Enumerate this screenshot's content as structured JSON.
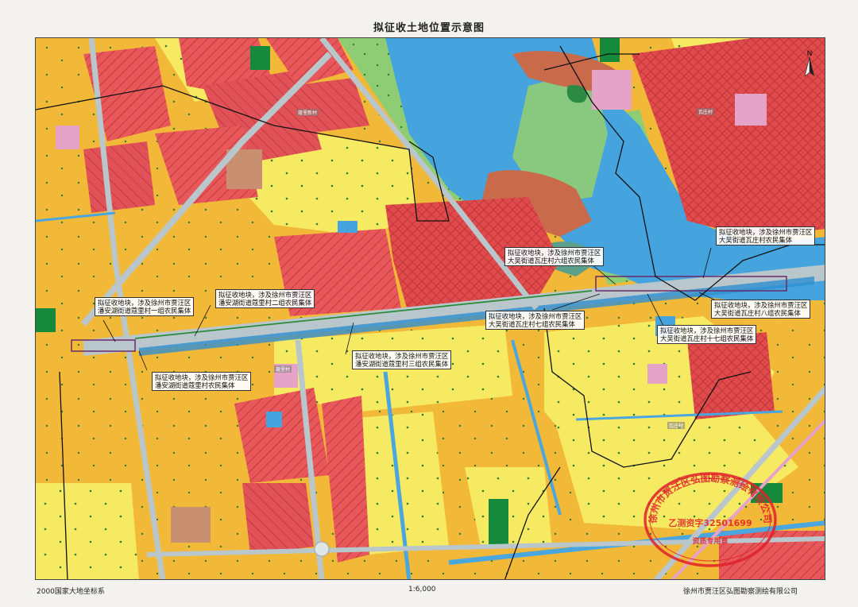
{
  "title": "拟征收土地位置示意图",
  "north_symbol": "N",
  "labels": [
    {
      "lines": [
        "拟征收地块，涉及徐州市贾汪区",
        "潘安湖街道蔻里村一组农民集体"
      ]
    },
    {
      "lines": [
        "拟征收地块，涉及徐州市贾汪区",
        "潘安湖街道蔻里村二组农民集体"
      ]
    },
    {
      "lines": [
        "拟征收地块，涉及徐州市贾汪区",
        "潘安湖街道蔻里村农民集体"
      ]
    },
    {
      "lines": [
        "拟征收地块，涉及徐州市贾汪区",
        "潘安湖街道蔻里村三组农民集体"
      ]
    },
    {
      "lines": [
        "拟征收地块，涉及徐州市贾汪区",
        "大吴街道瓦庄村六组农民集体"
      ]
    },
    {
      "lines": [
        "拟征收地块，涉及徐州市贾汪区",
        "大吴街道瓦庄村七组农民集体"
      ]
    },
    {
      "lines": [
        "拟征收地块，涉及徐州市贾汪区",
        "大吴街道瓦庄村农民集体"
      ]
    },
    {
      "lines": [
        "拟征收地块，涉及徐州市贾汪区",
        "大吴街道瓦庄村八组农民集体"
      ]
    },
    {
      "lines": [
        "拟征收地块，涉及徐州市贾汪区",
        "大吴街道瓦庄村十七组农民集体"
      ]
    }
  ],
  "villages": [
    "蔻里新村",
    "蔻里村",
    "瓦庄村",
    "瓦庄村"
  ],
  "stamp": {
    "outer_text": "徐州市贾汪区弘图勘察测绘有限公司",
    "center_text": "乙测资字32501699",
    "bottom_text": "资质专用章",
    "color": "#e0202a"
  },
  "footer": {
    "coordinate_system": "2000国家大地坐标系",
    "scale": "1:6,000",
    "company": "徐州市贾汪区弘图勘察测绘有限公司"
  },
  "colors": {
    "residential": "#e8585b",
    "farmland": "#f5e35f",
    "forest": "#f2b735",
    "water": "#4aa6df",
    "grass": "#82c870",
    "road": "#b9c7cc",
    "hatch": "#b22a2a",
    "mud": "#c96a4a",
    "dark_green": "#168a3c",
    "pink": "#e6a3c8",
    "boundary": "#111111"
  }
}
